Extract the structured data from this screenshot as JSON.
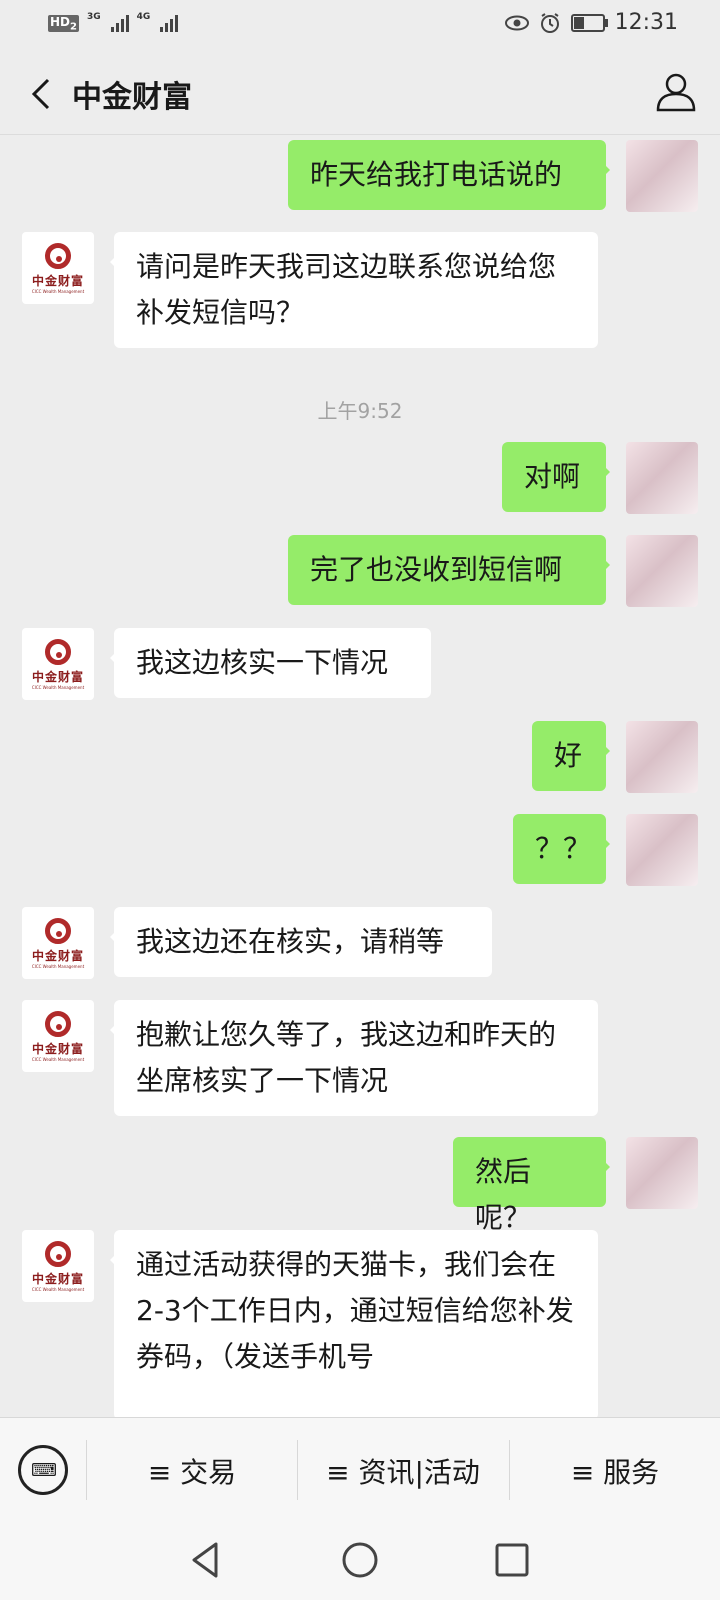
{
  "status_bar": {
    "hd_label": "HD",
    "hd_sub": "2",
    "network_1": "3G",
    "network_2": "4G",
    "time": "12:31",
    "battery_level": 0.4
  },
  "header": {
    "title": "中金财富"
  },
  "bot_logo": {
    "name": "中金财富",
    "subtitle": "CICC Wealth Management"
  },
  "messages": [
    {
      "side": "me",
      "text": "昨天给我打电话说的"
    },
    {
      "side": "them",
      "text": "请问是昨天我司这边联系您说给您补发短信吗？"
    },
    {
      "type": "time",
      "text": "上午9:52"
    },
    {
      "side": "me",
      "text": "对啊"
    },
    {
      "side": "me",
      "text": "完了也没收到短信啊"
    },
    {
      "side": "them",
      "text": "我这边核实一下情况"
    },
    {
      "side": "me",
      "text": "好"
    },
    {
      "side": "me",
      "text": "？？"
    },
    {
      "side": "them",
      "text": "我这边还在核实，请稍等"
    },
    {
      "side": "them",
      "text": "抱歉让您久等了，我这边和昨天的坐席核实了一下情况"
    },
    {
      "side": "me",
      "text": "然后呢？"
    },
    {
      "side": "them",
      "text": "通过活动获得的天猫卡，我们会在2-3个工作日内，通过短信给您补发券码，（发送手机号"
    }
  ],
  "bottom_menu": {
    "items": [
      "≡ 交易",
      "≡ 资讯|活动",
      "≡ 服务"
    ]
  },
  "icons": {
    "back": "back-arrow-icon",
    "profile": "user-profile-icon",
    "keyboard": "keyboard-icon",
    "nav_back": "nav-back-icon",
    "nav_home": "nav-home-icon",
    "nav_recent": "nav-recent-icon"
  },
  "colors": {
    "my_bubble": "#95ec69",
    "their_bubble": "#ffffff",
    "background": "#ededed",
    "brand_red": "#b02a2a"
  }
}
